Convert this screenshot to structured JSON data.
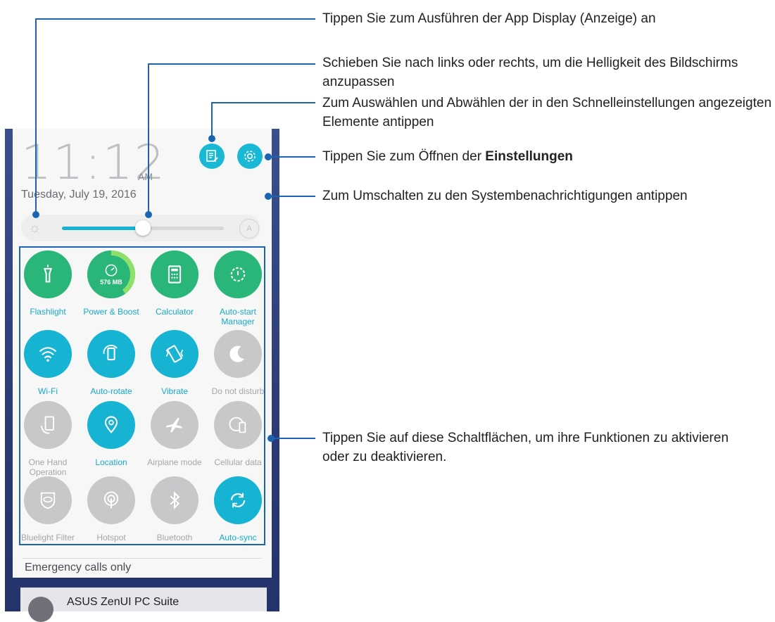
{
  "phone": {
    "time": "11:12",
    "ampm": "AM",
    "date": "Tuesday, July 19, 2016",
    "brightness_level": 0.5,
    "emergency_text": "Emergency calls only",
    "notification_title": "ASUS ZenUI PC Suite"
  },
  "tiles": [
    {
      "label": "Flashlight",
      "state": "green",
      "icon": "flashlight-icon"
    },
    {
      "label": "Power & Boost",
      "state": "green",
      "icon": "speedometer-icon",
      "value": "576 MB"
    },
    {
      "label": "Calculator",
      "state": "green",
      "icon": "calculator-icon"
    },
    {
      "label": "Auto-start\nManager",
      "state": "green",
      "icon": "gear-power-icon"
    },
    {
      "label": "Wi-Fi",
      "state": "on",
      "icon": "wifi-icon"
    },
    {
      "label": "Auto-rotate",
      "state": "on",
      "icon": "rotate-icon"
    },
    {
      "label": "Vibrate",
      "state": "on",
      "icon": "vibrate-icon"
    },
    {
      "label": "Do not disturb",
      "state": "off",
      "icon": "moon-icon"
    },
    {
      "label": "One Hand\nOperation",
      "state": "off",
      "icon": "one-hand-icon"
    },
    {
      "label": "Location",
      "state": "on",
      "icon": "location-pin-icon"
    },
    {
      "label": "Airplane mode",
      "state": "off",
      "icon": "airplane-icon"
    },
    {
      "label": "Cellular data",
      "state": "off",
      "icon": "globe-phone-icon"
    },
    {
      "label": "Bluelight Filter",
      "state": "off",
      "icon": "eye-shield-icon"
    },
    {
      "label": "Hotspot",
      "state": "off",
      "icon": "hotspot-icon"
    },
    {
      "label": "Bluetooth",
      "state": "off",
      "icon": "bluetooth-icon"
    },
    {
      "label": "Auto-sync",
      "state": "on",
      "icon": "sync-icon"
    }
  ],
  "annotations": {
    "display": "Tippen Sie zum Ausführen der App Display (Anzeige) an",
    "brightness": "Schieben Sie nach links oder rechts, um die Helligkeit des Bildschirms anzupassen",
    "edit_prefix": "Zum Auswählen und Abwählen der in den Schnelleinstellungen angezeigten Elemente antippen",
    "settings_prefix": "Tippen Sie zum Öffnen der ",
    "settings_bold": "Einstellungen",
    "notifications": "Zum Umschalten zu den Systembenachrichtigungen antippen",
    "buttons": "Tippen Sie auf diese Schaltflächen, um ihre Funktionen zu aktivieren oder zu deaktivieren."
  },
  "colors": {
    "accent": "#17b3d2",
    "green": "#2bb679",
    "off": "#c8c8ca",
    "annotation": "#1a64b0"
  }
}
